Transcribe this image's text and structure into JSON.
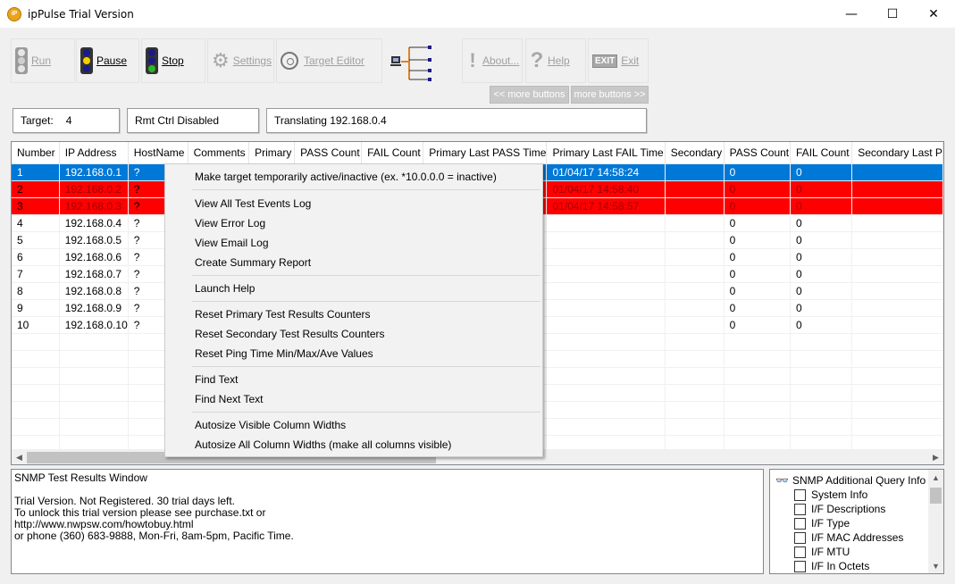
{
  "window": {
    "title": "ipPulse Trial Version",
    "icon_text": "iP",
    "minimize": "—",
    "maximize": "☐",
    "close": "✕"
  },
  "toolbar": {
    "run": "Run",
    "pause": "Pause",
    "stop": "Stop",
    "settings": "Settings",
    "target_editor": "Target Editor",
    "about": "About...",
    "help": "Help",
    "exit": "Exit",
    "exit_icon_text": "EXIT",
    "less_buttons": "<< more buttons",
    "more_buttons": "more buttons >>"
  },
  "status": {
    "target_label": "Target:",
    "target_value": "4",
    "remote": "Rmt Ctrl Disabled",
    "message": "Translating 192.168.0.4"
  },
  "grid": {
    "columns": [
      "Number",
      "IP Address",
      "HostName",
      "Comments",
      "Primary",
      "PASS Count",
      "FAIL Count",
      "Primary Last PASS Time",
      "Primary Last FAIL Time",
      "Secondary",
      "PASS Count",
      "FAIL Count",
      "Secondary Last P"
    ],
    "rows": [
      {
        "n": "1",
        "ip": "192.168.0.1",
        "host": "?",
        "fail_time": "01/04/17 14:58:24",
        "pass2": "0",
        "fail2": "0",
        "state": "selected"
      },
      {
        "n": "2",
        "ip": "192.168.0.2",
        "host": "?",
        "fail_time": "01/04/17 14:58:40",
        "pass2": "0",
        "fail2": "0",
        "state": "failed"
      },
      {
        "n": "3",
        "ip": "192.168.0.3",
        "host": "?",
        "fail_time": "01/04/17 14:58:57",
        "pass2": "0",
        "fail2": "0",
        "state": "failed"
      },
      {
        "n": "4",
        "ip": "192.168.0.4",
        "host": "?",
        "fail_time": "",
        "pass2": "0",
        "fail2": "0",
        "state": "normal"
      },
      {
        "n": "5",
        "ip": "192.168.0.5",
        "host": "?",
        "fail_time": "",
        "pass2": "0",
        "fail2": "0",
        "state": "normal"
      },
      {
        "n": "6",
        "ip": "192.168.0.6",
        "host": "?",
        "fail_time": "",
        "pass2": "0",
        "fail2": "0",
        "state": "normal"
      },
      {
        "n": "7",
        "ip": "192.168.0.7",
        "host": "?",
        "fail_time": "",
        "pass2": "0",
        "fail2": "0",
        "state": "normal"
      },
      {
        "n": "8",
        "ip": "192.168.0.8",
        "host": "?",
        "fail_time": "",
        "pass2": "0",
        "fail2": "0",
        "state": "normal"
      },
      {
        "n": "9",
        "ip": "192.168.0.9",
        "host": "?",
        "fail_time": "",
        "pass2": "0",
        "fail2": "0",
        "state": "normal"
      },
      {
        "n": "10",
        "ip": "192.168.0.10",
        "host": "?",
        "fail_time": "",
        "pass2": "0",
        "fail2": "0",
        "state": "normal"
      }
    ]
  },
  "context_menu": {
    "items": [
      "Make target temporarily active/inactive (ex. *10.0.0.0 = inactive)",
      "View All Test Events Log",
      "View Error Log",
      "View Email Log",
      "Create Summary Report",
      "Launch Help",
      "Reset Primary Test Results Counters",
      "Reset Secondary Test Results Counters",
      "Reset Ping Time Min/Max/Ave Values",
      "Find Text",
      "Find Next Text",
      "Autosize Visible Column Widths",
      "Autosize All Column Widths (make all columns visible)"
    ]
  },
  "snmp": {
    "title": "SNMP Test Results Window",
    "lines": [
      "Trial Version. Not Registered.  30 trial days left.",
      "To unlock this trial version please see purchase.txt or",
      "http://www.nwpsw.com/howtobuy.html",
      "or phone (360) 683-9888, Mon-Fri, 8am-5pm, Pacific Time."
    ]
  },
  "query": {
    "title": "SNMP Additional Query Info",
    "items": [
      "System Info",
      "I/F Descriptions",
      "I/F Type",
      "I/F MAC Addresses",
      "I/F MTU",
      "I/F In Octets"
    ]
  },
  "colors": {
    "selected_row": "#0078d7",
    "failed_row": "#ff0000"
  }
}
